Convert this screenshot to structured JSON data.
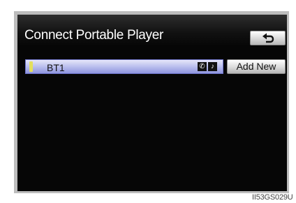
{
  "screen": {
    "title": "Connect Portable Player",
    "back_button_icon": "return-arrow-icon"
  },
  "device_list": [
    {
      "name": "BT1",
      "selected": true,
      "profile_icons": [
        "phone-icon",
        "music-note-icon"
      ]
    }
  ],
  "add_new_label": "Add New",
  "caption": "II53GS029U",
  "colors": {
    "screen_bg": "#060606",
    "selected_row": "#bfc3ef",
    "indicator": "#e3df5e"
  }
}
